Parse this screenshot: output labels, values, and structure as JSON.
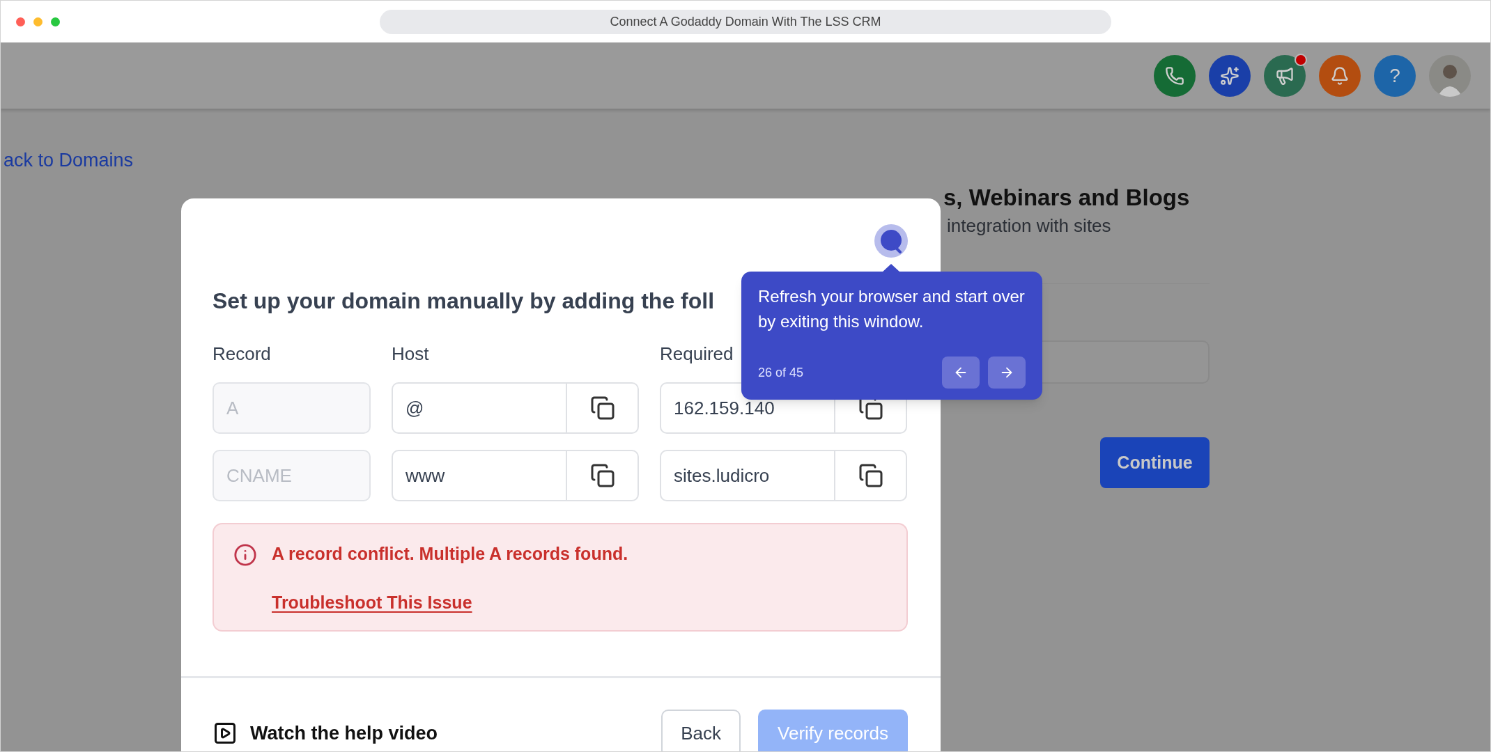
{
  "window": {
    "title": "Connect A Godaddy Domain With The LSS CRM"
  },
  "header": {
    "actions": [
      {
        "kind": "phone",
        "notification": false
      },
      {
        "kind": "sparkles",
        "notification": false
      },
      {
        "kind": "megaphone",
        "notification": true
      },
      {
        "kind": "bell",
        "notification": false
      },
      {
        "kind": "help",
        "label": "?",
        "notification": false
      },
      {
        "kind": "avatar",
        "notification": false
      }
    ]
  },
  "page": {
    "back_link": "ack to Domains",
    "heading": "s, Webinars and Blogs",
    "subheading": "integration with sites",
    "continue_button": "Continue"
  },
  "modal": {
    "title": "Set up your domain manually by adding the foll",
    "columns": [
      "Record",
      "Host",
      "Required"
    ],
    "rows": [
      {
        "record": "A",
        "host": "@",
        "value": "162.159.140"
      },
      {
        "record": "CNAME",
        "host": "www",
        "value": "sites.ludicro"
      }
    ],
    "alert": {
      "message": "A record conflict. Multiple A records found.",
      "link": "Troubleshoot This Issue"
    },
    "help_link": "Watch the help video",
    "buttons": [
      {
        "label": "Back",
        "kind": "secondary",
        "disabled": false
      },
      {
        "label": "Verify records",
        "kind": "primary",
        "disabled": true
      }
    ]
  },
  "tour_tooltip": {
    "text": "Refresh your browser and start over by exiting this window.",
    "step": "26 of 45"
  }
}
